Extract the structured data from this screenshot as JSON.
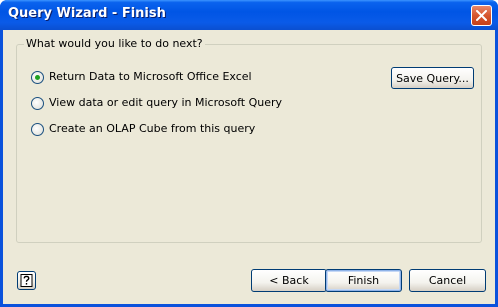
{
  "window": {
    "title": "Query Wizard - Finish",
    "close_icon": "close-icon"
  },
  "group": {
    "legend": "What would you like to do next?",
    "options": [
      {
        "label": "Return Data to Microsoft Office Excel",
        "selected": true
      },
      {
        "label": "View data or edit query in Microsoft Query",
        "selected": false
      },
      {
        "label": "Create an OLAP Cube from this query",
        "selected": false
      }
    ],
    "save_query_label": "Save Query..."
  },
  "footer": {
    "help_icon": "help-icon",
    "back_label": "< Back",
    "finish_label": "Finish",
    "cancel_label": "Cancel"
  },
  "colors": {
    "titlebar": "#0055e5",
    "dialog_bg": "#ece9d8",
    "radio_selected": "#21a121",
    "close_button": "#d6562d"
  }
}
